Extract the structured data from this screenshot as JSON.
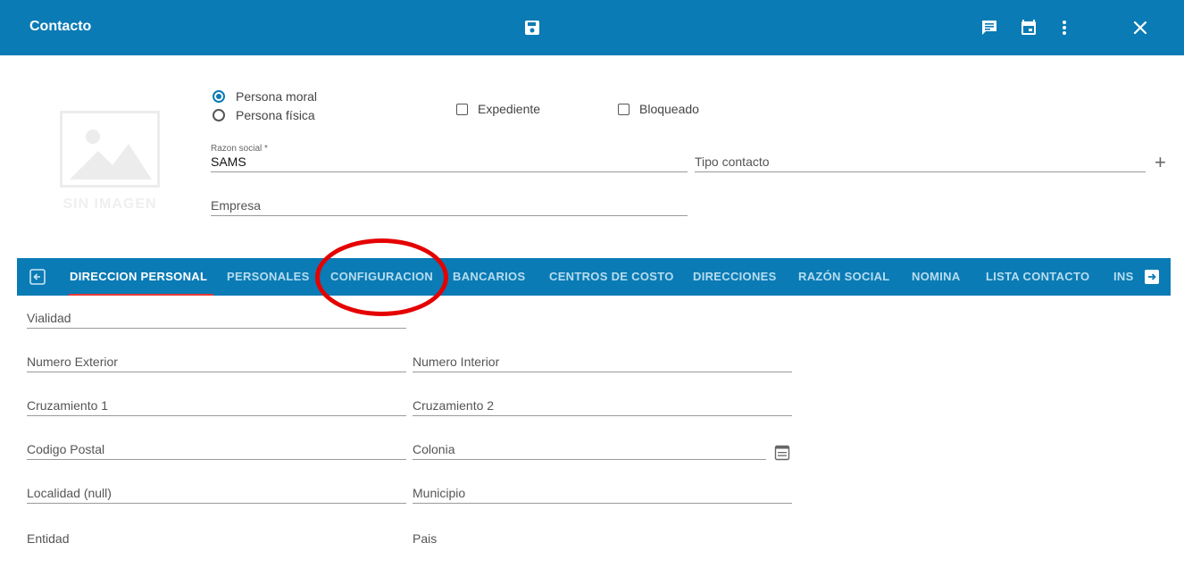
{
  "header": {
    "title": "Contacto",
    "icons": [
      "save-icon",
      "notes-icon",
      "calendar-icon",
      "more-vert-icon",
      "close-icon"
    ]
  },
  "photo": {
    "caption": "SIN IMAGEN"
  },
  "person_type": {
    "options": [
      {
        "label": "Persona moral",
        "selected": true
      },
      {
        "label": "Persona física",
        "selected": false
      }
    ]
  },
  "flags": {
    "expediente": {
      "label": "Expediente",
      "checked": false
    },
    "bloqueado": {
      "label": "Bloqueado",
      "checked": false
    }
  },
  "form": {
    "razon_social": {
      "label": "Razon social *",
      "value": "SAMS"
    },
    "tipo_contacto": {
      "placeholder": "Tipo contacto"
    },
    "empresa": {
      "placeholder": "Empresa"
    }
  },
  "tabs": [
    {
      "label": "DIRECCION PERSONAL",
      "active": true
    },
    {
      "label": "PERSONALES"
    },
    {
      "label": "CONFIGURACION"
    },
    {
      "label": "BANCARIOS"
    },
    {
      "label": "CENTROS DE COSTO"
    },
    {
      "label": "DIRECCIONES"
    },
    {
      "label": "RAZÓN SOCIAL"
    },
    {
      "label": "NOMINA"
    },
    {
      "label": "LISTA CONTACTO"
    },
    {
      "label": "INS"
    }
  ],
  "address": {
    "vialidad": "Vialidad",
    "numero_exterior": "Numero Exterior",
    "numero_interior": "Numero Interior",
    "cruzamiento_1": "Cruzamiento 1",
    "cruzamiento_2": "Cruzamiento 2",
    "codigo_postal": "Codigo Postal",
    "colonia": "Colonia",
    "localidad": "Localidad (null)",
    "municipio": "Municipio",
    "entidad": "Entidad",
    "pais": "Pais"
  },
  "colors": {
    "primary": "#0a7bb5",
    "annotation": "#e50000",
    "tab_indicator": "#e53935"
  }
}
